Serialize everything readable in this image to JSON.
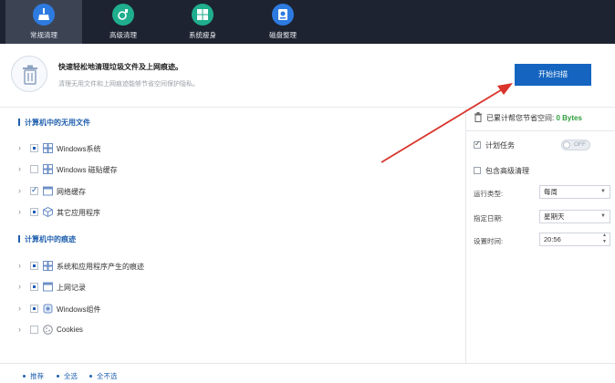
{
  "tabs": [
    {
      "label": "常规清理",
      "icon": "broom-icon",
      "active": true
    },
    {
      "label": "高级清理",
      "icon": "advanced-clean-icon",
      "active": false
    },
    {
      "label": "系统瘦身",
      "icon": "windows-icon",
      "active": false
    },
    {
      "label": "磁盘整理",
      "icon": "disk-icon",
      "active": false
    }
  ],
  "hero": {
    "title": "快速轻松地清理垃圾文件及上网痕迹。",
    "subtitle": "清理无用文件和上网痕迹能够节省空间保护隐私。",
    "scan_button": "开始扫描"
  },
  "sections": [
    {
      "title": "计算机中的无用文件",
      "items": [
        {
          "label": "Windows系统",
          "check": "partial",
          "icon": "windows-icon"
        },
        {
          "label": "Windows 磁贴缓存",
          "check": "none",
          "icon": "tiles-icon"
        },
        {
          "label": "网络缓存",
          "check": "checked",
          "icon": "network-icon"
        },
        {
          "label": "其它应用程序",
          "check": "partial",
          "icon": "apps-icon"
        }
      ]
    },
    {
      "title": "计算机中的痕迹",
      "items": [
        {
          "label": "系统和应用程序产生的痕迹",
          "check": "partial",
          "icon": "windows-icon"
        },
        {
          "label": "上网记录",
          "check": "partial",
          "icon": "browser-icon"
        },
        {
          "label": "Windows组件",
          "check": "partial",
          "icon": "component-icon"
        },
        {
          "label": "Cookies",
          "check": "none",
          "icon": "cookie-icon"
        }
      ]
    }
  ],
  "right": {
    "saved_label": "已累计帮您节省空间:",
    "saved_value": "0 Bytes",
    "scheduled_label": "计划任务",
    "toggle_label": "OFF",
    "include_advanced_label": "包含高级清理",
    "run_type_label": "运行类型:",
    "run_type_value": "每周",
    "date_label": "指定日期:",
    "date_value": "星期天",
    "time_label": "设置时间:",
    "time_value": "20:56"
  },
  "footer": {
    "recommend": "推荐",
    "select_all": "全选",
    "select_none": "全不选"
  },
  "colors": {
    "topbar": "#1d2330",
    "accent": "#1565c0",
    "section_title": "#1f5fae",
    "saved_value": "#2f9d3c",
    "annotation_arrow": "#d9342b"
  }
}
